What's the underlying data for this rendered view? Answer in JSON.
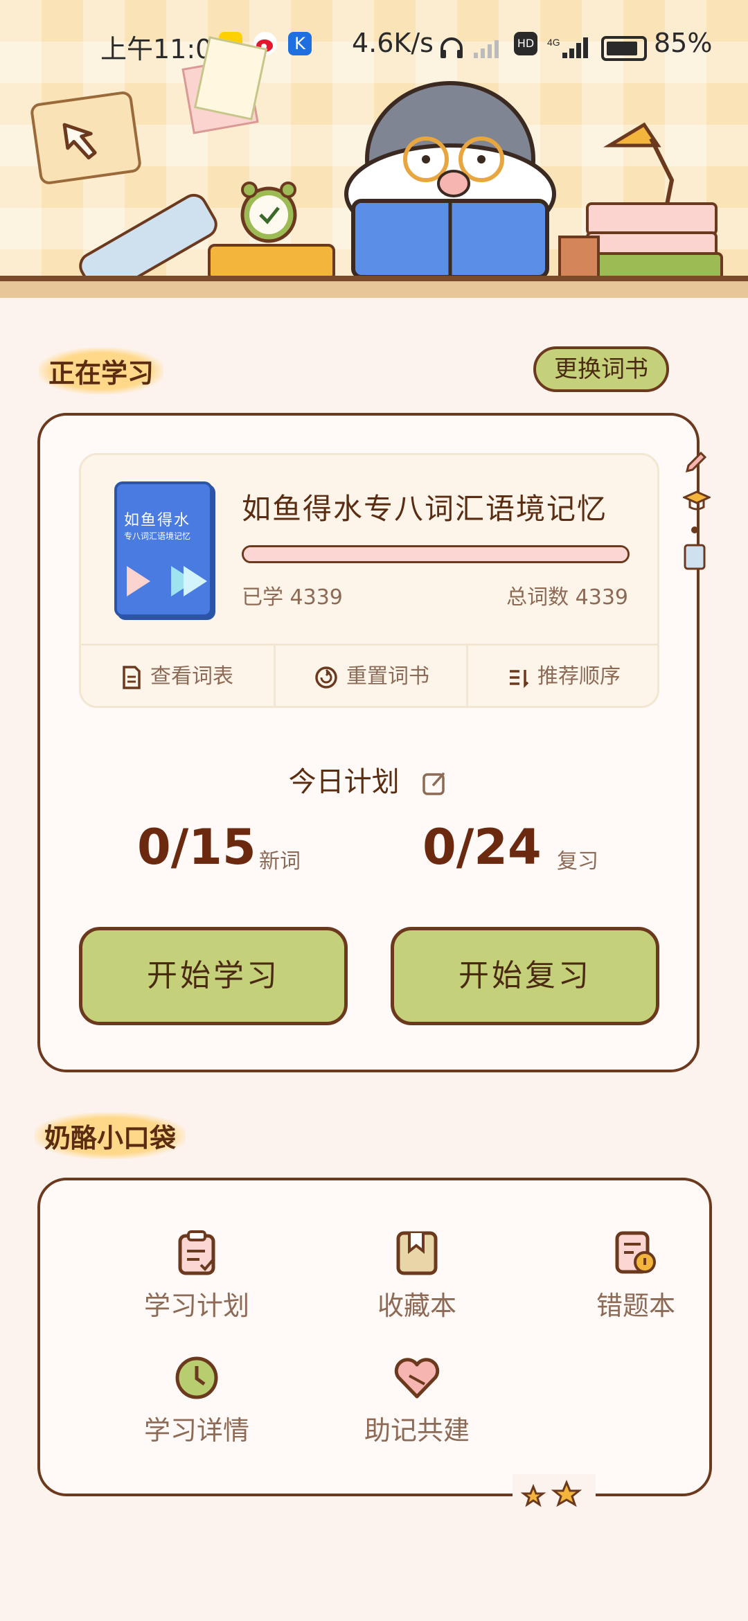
{
  "status_bar": {
    "time": "上午11:09",
    "net_speed": "4.6K/s",
    "battery": "85%"
  },
  "header": {
    "back_icon": "back-arrow-icon"
  },
  "current": {
    "section_title": "正在学习",
    "change_book_label": "更换词书",
    "book": {
      "cover_title": "如鱼得水",
      "cover_subtitle": "专八词汇语境记忆",
      "name": "如鱼得水专八词汇语境记忆",
      "progress": 1.0,
      "learned": "已学 4339",
      "total": "总词数 4339"
    },
    "actions": [
      {
        "label": "查看词表",
        "icon": "document-icon"
      },
      {
        "label": "重置词书",
        "icon": "reset-icon"
      },
      {
        "label": "推荐顺序",
        "icon": "sort-icon"
      }
    ],
    "plan_title": "今日计划",
    "new_count": "0/15",
    "new_unit": "新词",
    "review_count": "0/24",
    "review_unit": "复习",
    "start_learn": "开始学习",
    "start_review": "开始复习"
  },
  "pocket": {
    "section_title": "奶酪小口袋",
    "items": [
      {
        "label": "学习计划",
        "icon": "clipboard-icon"
      },
      {
        "label": "收藏本",
        "icon": "bookmark-icon"
      },
      {
        "label": "错题本",
        "icon": "error-book-icon"
      },
      {
        "label": "学习详情",
        "icon": "clock-icon"
      },
      {
        "label": "助记共建",
        "icon": "heart-link-icon"
      }
    ]
  },
  "colors": {
    "accent": "#c5d07a",
    "border": "#6b3a1e",
    "background": "#fdf3ee",
    "progress_fill": "#fbd6d3"
  }
}
